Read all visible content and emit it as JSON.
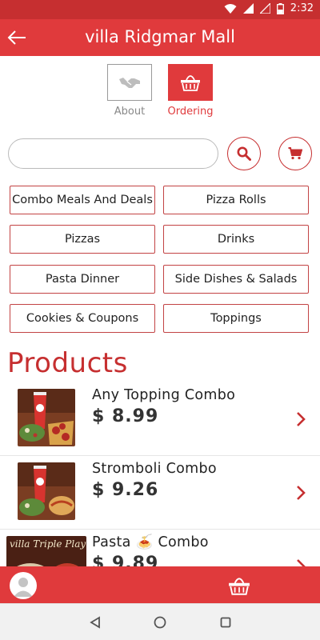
{
  "status_bar": {
    "time": "2:32",
    "icons": [
      "wifi-icon",
      "signal-icon",
      "signal-icon",
      "battery-icon"
    ]
  },
  "app_bar": {
    "title": "villa Ridgmar Mall",
    "back_icon": "arrow-left-icon"
  },
  "tabs": [
    {
      "label": "About",
      "icon": "handshake-icon",
      "active": false
    },
    {
      "label": "Ordering",
      "icon": "basket-icon",
      "active": true
    }
  ],
  "search": {
    "value": "",
    "placeholder": ""
  },
  "categories": [
    "Combo Meals And Deals",
    "Pizza Rolls",
    "Pizzas",
    "Drinks",
    "Pasta Dinner",
    "Side Dishes & Salads",
    "Cookies & Coupons",
    "Toppings"
  ],
  "products_heading": "Products",
  "products": [
    {
      "name": "Any Topping Combo",
      "price": "$ 8.99"
    },
    {
      "name": "Stromboli Combo",
      "price": "$ 9.26"
    },
    {
      "name": "Pasta 🍝 Combo",
      "price": "$ 9.89",
      "image_text": "villa Triple Play"
    }
  ],
  "colors": {
    "primary": "#e03a3c",
    "primary_dark": "#c62f30",
    "border": "#c24344"
  }
}
